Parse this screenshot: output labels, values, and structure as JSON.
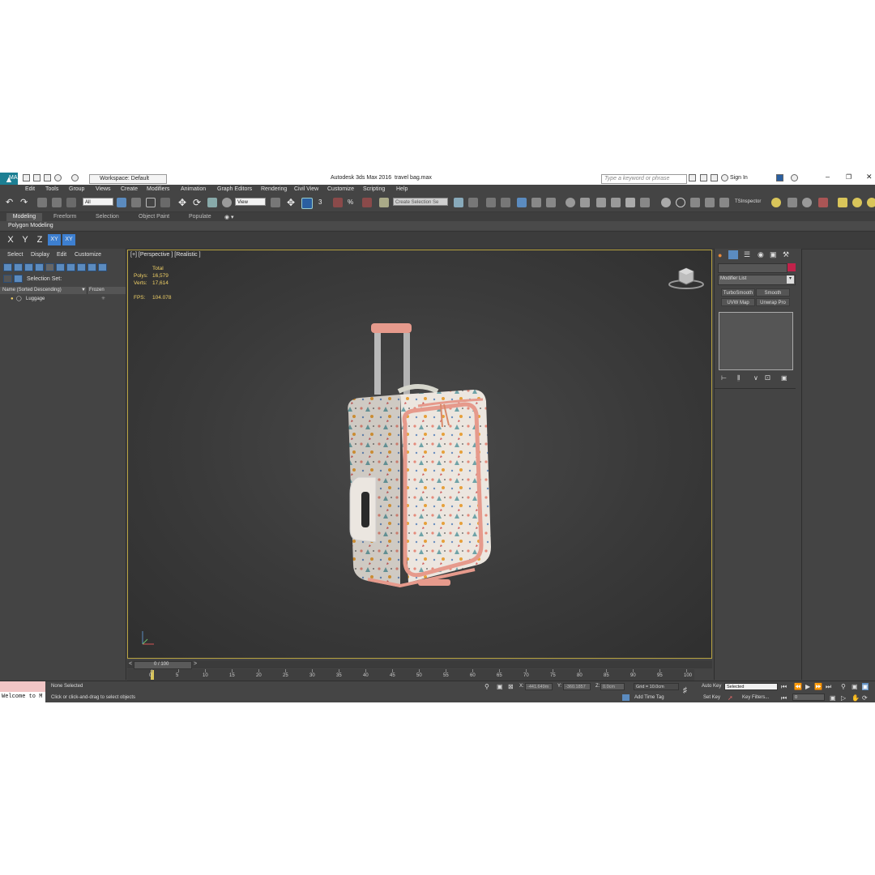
{
  "window": {
    "title": "Autodesk 3ds Max 2016",
    "file": "travel bag.max",
    "workspace": "Workspace: Default",
    "search_placeholder": "Type a keyword or phrase",
    "sign_in": "Sign In",
    "logo_text": "MAX"
  },
  "menu": [
    "Edit",
    "Tools",
    "Group",
    "Views",
    "Create",
    "Modifiers",
    "Animation",
    "Graph Editors",
    "Rendering",
    "Civil View",
    "Customize",
    "Scripting",
    "Help"
  ],
  "toolbar": {
    "filter_value": "All",
    "ref_coord_value": "View",
    "selection_set_placeholder": "Create Selection Se",
    "ts_inspector": "TSInspector"
  },
  "ribbon": {
    "tabs": [
      "Modeling",
      "Freeform",
      "Selection",
      "Object Paint",
      "Populate"
    ],
    "active_tab": "Modeling",
    "panel_label": "Polygon Modeling"
  },
  "axis_constraints": [
    "X",
    "Y",
    "Z",
    "XY",
    "XY"
  ],
  "scene_explorer": {
    "menu": [
      "Select",
      "Display",
      "Edit",
      "Customize"
    ],
    "selection_set_label": "Selection Set:",
    "col_name": "Name (Sorted Descending)",
    "col_frozen": "Frozen",
    "items": [
      {
        "name": "Luggage"
      }
    ]
  },
  "viewport": {
    "label": "[+] [Perspective ] [Realistic ]",
    "stats": {
      "total_label": "Total",
      "polys_label": "Polys:",
      "polys": "16,579",
      "verts_label": "Verts:",
      "verts": "17,614",
      "fps_label": "FPS:",
      "fps": "104.078"
    }
  },
  "command_panel": {
    "modifier_list": "Modifier List",
    "buttons": [
      "TurboSmooth",
      "Smooth",
      "UVW Map",
      "Unwrap Pro"
    ]
  },
  "timeline": {
    "frame_display": "0 / 100",
    "ticks": [
      "0",
      "5",
      "10",
      "15",
      "20",
      "25",
      "30",
      "35",
      "40",
      "45",
      "50",
      "55",
      "60",
      "65",
      "70",
      "75",
      "80",
      "85",
      "90",
      "95",
      "100"
    ]
  },
  "status": {
    "maxscript": "Welcome to M",
    "selection": "None Selected",
    "prompt": "Click or click-and-drag to select objects",
    "x_label": "X:",
    "x": "-441.649m",
    "y_label": "Y:",
    "y": "-360.1857",
    "z_label": "Z:",
    "z": "0.0cm",
    "grid": "Grid = 10.0cm",
    "add_time_tag": "Add Time Tag",
    "auto_key": "Auto Key",
    "set_key": "Set Key",
    "key_mode_value": "Selected",
    "key_filters": "Key Filters...",
    "current_frame": "0"
  },
  "colors": {
    "accent": "#5b8bbf",
    "viewport_border": "#b8a340",
    "stats_text": "#f0d066"
  }
}
